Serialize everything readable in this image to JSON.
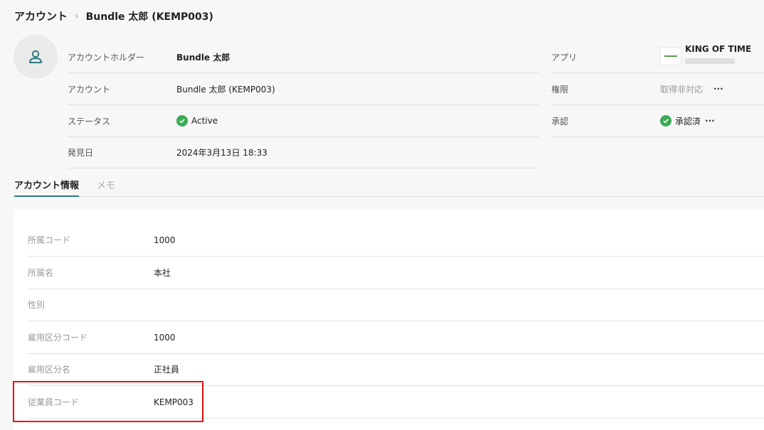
{
  "breadcrumb": {
    "root": "アカウント",
    "separator": "›",
    "current": "Bundle 太郎 (KEMP003)"
  },
  "summary": {
    "holder_label": "アカウントホルダー",
    "holder_value": "Bundle 太郎",
    "account_label": "アカウント",
    "account_value": "Bundle 太郎 (KEMP003)",
    "status_label": "ステータス",
    "status_value": "Active",
    "discovered_label": "発見日",
    "discovered_value": "2024年3月13日 18:33"
  },
  "right": {
    "app_label": "アプリ",
    "app_name": "KING OF TIME",
    "perm_label": "権限",
    "perm_value": "取得非対応",
    "perm_more": "···",
    "approval_label": "承認",
    "approval_value": "承認済",
    "approval_more": "···"
  },
  "tabs": [
    {
      "label": "アカウント情報",
      "active": true
    },
    {
      "label": "メモ",
      "active": false
    }
  ],
  "details": [
    {
      "label": "所属コード",
      "value": "1000"
    },
    {
      "label": "所属名",
      "value": "本社"
    },
    {
      "label": "性別",
      "value": ""
    },
    {
      "label": "雇用区分コード",
      "value": "1000"
    },
    {
      "label": "雇用区分名",
      "value": "正社員"
    },
    {
      "label": "従業員コード",
      "value": "KEMP003"
    }
  ],
  "icons": {
    "avatar": "user-icon",
    "status": "check-circle-icon",
    "approval": "check-circle-icon",
    "app_logo": "king-of-time-logo"
  },
  "colors": {
    "success": "#3aaa55",
    "tab_accent": "#2c7a7b",
    "highlight": "#e11111"
  }
}
